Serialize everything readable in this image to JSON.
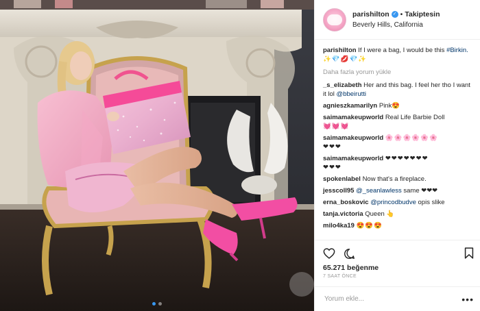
{
  "post": {
    "username": "parishilton",
    "follow_label": "Takiptesin",
    "separator": "•",
    "location": "Beverly Hills, California",
    "verified_icon": "verified-check-icon"
  },
  "caption": {
    "username": "parishilton",
    "text": "If I were a bag, I would be this",
    "hashtag": "#Birkin.",
    "emoji": "✨💎💋💎✨"
  },
  "load_more_label": "Daha fazla yorum yükle",
  "comments": [
    {
      "user": "_s_elizabeth",
      "text": "Her and this bag. I feel her tho I want it lol",
      "mention": "@bbeirutti"
    },
    {
      "user": "agnieszkamarilyn",
      "text": "Pink😍",
      "mention": ""
    },
    {
      "user": "saimamakeupworld",
      "text": "Real Life Barbie Doll",
      "extra": "💓💓💓"
    },
    {
      "user": "saimamakeupworld",
      "text": "🌸🌸🌸🌸🌸🌸",
      "extra": "❤❤❤"
    },
    {
      "user": "saimamakeupworld",
      "text": "❤❤❤❤❤❤❤",
      "extra": "❤❤❤"
    },
    {
      "user": "spokenlabel",
      "text": "Now that's a fireplace.",
      "mention": ""
    },
    {
      "user": "jesscoll95",
      "text": "same ❤❤❤",
      "mention": "@_seanlawless"
    },
    {
      "user": "erna_boskovic",
      "text": "opis slike",
      "mention": "@princodbudve"
    },
    {
      "user": "tanja.victoria",
      "text": "Queen 👆",
      "mention": ""
    },
    {
      "user": "milo4ka19",
      "text": "😍😍😍",
      "mention": ""
    }
  ],
  "actions": {
    "like_icon": "heart-icon",
    "comment_icon": "comment-icon",
    "save_icon": "bookmark-icon"
  },
  "likes_label": "65.271 beğenme",
  "time_label": "7 SAAT ÖNCE",
  "add_comment_placeholder": "Yorum ekle...",
  "more_options_label": "•••",
  "carousel": {
    "count": 2,
    "active": 0
  },
  "colors": {
    "link": "#003569",
    "accent": "#3897f0",
    "muted": "#999999",
    "text": "#262626"
  }
}
